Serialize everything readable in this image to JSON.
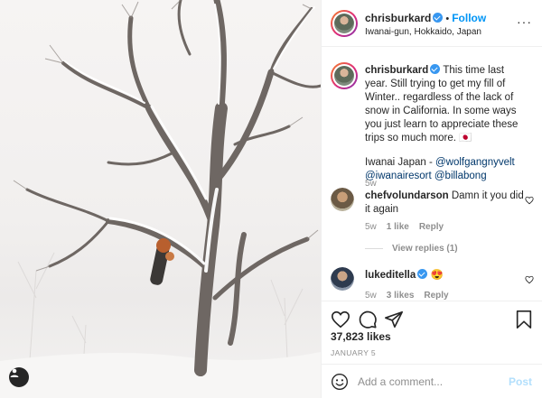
{
  "post": {
    "author": "chrisburkard",
    "follow_label": "Follow",
    "separator": "•",
    "location": "Iwanai-gun, Hokkaido, Japan"
  },
  "caption": {
    "username": "chrisburkard",
    "text_before": "This time last year. Still trying to get my fill of Winter.. regardless of the lack of snow in California. In some ways you just learn to appreciate these trips so much more. 🇯🇵",
    "tag_prefix": "Iwanai Japan - ",
    "mention1": "@wolfgangnyvelt",
    "mention2": "@iwanairesort",
    "mention3": "@billabong",
    "age": "5w"
  },
  "comments": [
    {
      "username": "chefvolundarson",
      "text": "Damn it you did it again",
      "age": "5w",
      "likes": "1 like",
      "reply": "Reply",
      "view_replies": "View replies (1)"
    },
    {
      "username": "lukeditella",
      "text": "😍",
      "age": "5w",
      "likes": "3 likes",
      "reply": "Reply"
    }
  ],
  "actions": {
    "likes_count": "37,823 likes",
    "date": "JANUARY 5"
  },
  "composer": {
    "placeholder": "Add a comment...",
    "post_label": "Post"
  },
  "icons": {
    "like": "heart-icon",
    "comment": "comment-icon",
    "share": "share-icon",
    "save": "bookmark-icon",
    "emoji": "emoji-icon",
    "more": "more-icon",
    "tag": "user-tag-icon",
    "verified": "verified-badge-icon"
  },
  "colors": {
    "accent": "#0095f6",
    "verified": "#3897f0",
    "post_disabled": "#b2dffc",
    "muted": "#8e8e8e"
  }
}
